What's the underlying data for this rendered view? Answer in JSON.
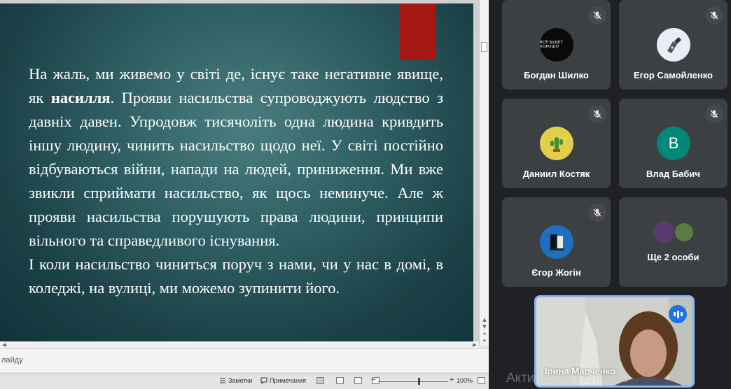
{
  "slide": {
    "paragraph1_before_bold": "На жаль, ми живемо у світі де, існує таке негативне явище, як ",
    "paragraph1_bold": "насилля",
    "paragraph1_after_bold": ". Прояви насильства супроводжують людство з давніх давен. Упродовж тисячоліть одна людина кривдить іншу людину, чинить насильство щодо неї. У світі постійно відбуваються війни, напади на людей, приниження. Ми вже звикли сприймати насильство, як щось неминуче. Але ж  прояви насильства порушують права людини, принципи вільного та справедливого існування.",
    "paragraph2": "І коли насильство чиниться поруч з нами, чи у нас в домі, в коледжі, на вулиці, ми можемо зупинити його.",
    "accent_color": "#a41714"
  },
  "notes_pane": {
    "text": "лайду"
  },
  "statusbar": {
    "notes_label": "Заметки",
    "comments_label": "Примечания",
    "zoom_minus": "−",
    "zoom_plus": "+",
    "zoom_value": "100%"
  },
  "participants": [
    {
      "name": "Богдан Шилко",
      "avatar_text": "ВСЁ БУДЕТ ХОРОШО",
      "muted": true
    },
    {
      "name": "Егор Самойленко",
      "muted": true
    },
    {
      "name": "Даниил Костяк",
      "muted": true
    },
    {
      "name": "Влад Бабич",
      "avatar_letter": "B",
      "muted": true
    },
    {
      "name": "Єгор Жогін",
      "muted": true
    }
  ],
  "more": {
    "label": "Ще 2 особи"
  },
  "active_speaker": {
    "name": "Ірина Марченко",
    "speaking": true
  },
  "watermark": {
    "text": "Активация Windows"
  },
  "icons": {
    "mute": "mic-off-icon",
    "speaking": "speaking-indicator-icon"
  }
}
